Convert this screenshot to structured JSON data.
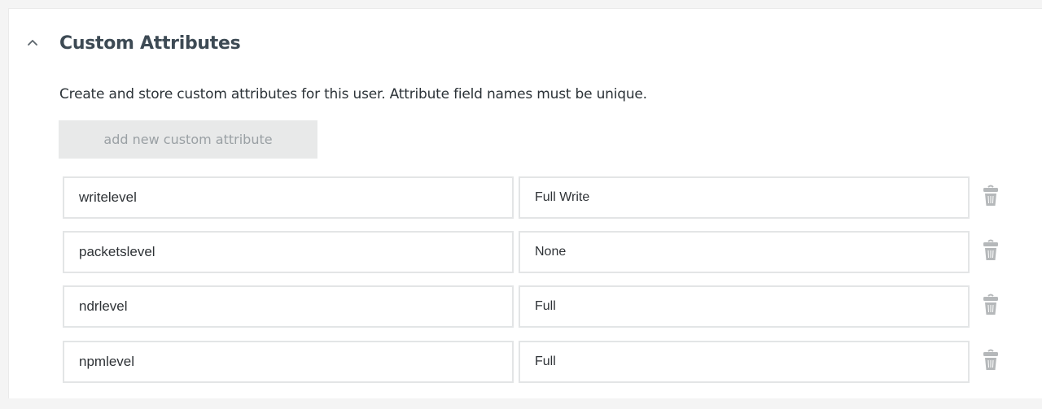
{
  "section": {
    "title": "Custom Attributes",
    "description": "Create and store custom attributes for this user. Attribute field names must be unique.",
    "add_button_label": "add new custom attribute"
  },
  "attributes": [
    {
      "name": "writelevel",
      "value": "Full Write"
    },
    {
      "name": "packetslevel",
      "value": "None"
    },
    {
      "name": "ndrlevel",
      "value": "Full"
    },
    {
      "name": "npmlevel",
      "value": "Full"
    }
  ],
  "icons": {
    "collapse": "chevron-up-icon",
    "delete": "trash-icon"
  },
  "colors": {
    "title": "#3d4a54",
    "button_bg": "#e8e9e9",
    "button_text": "#9aa0a4",
    "field_border": "#e3e5e6",
    "trash": "#b5b8ba"
  }
}
